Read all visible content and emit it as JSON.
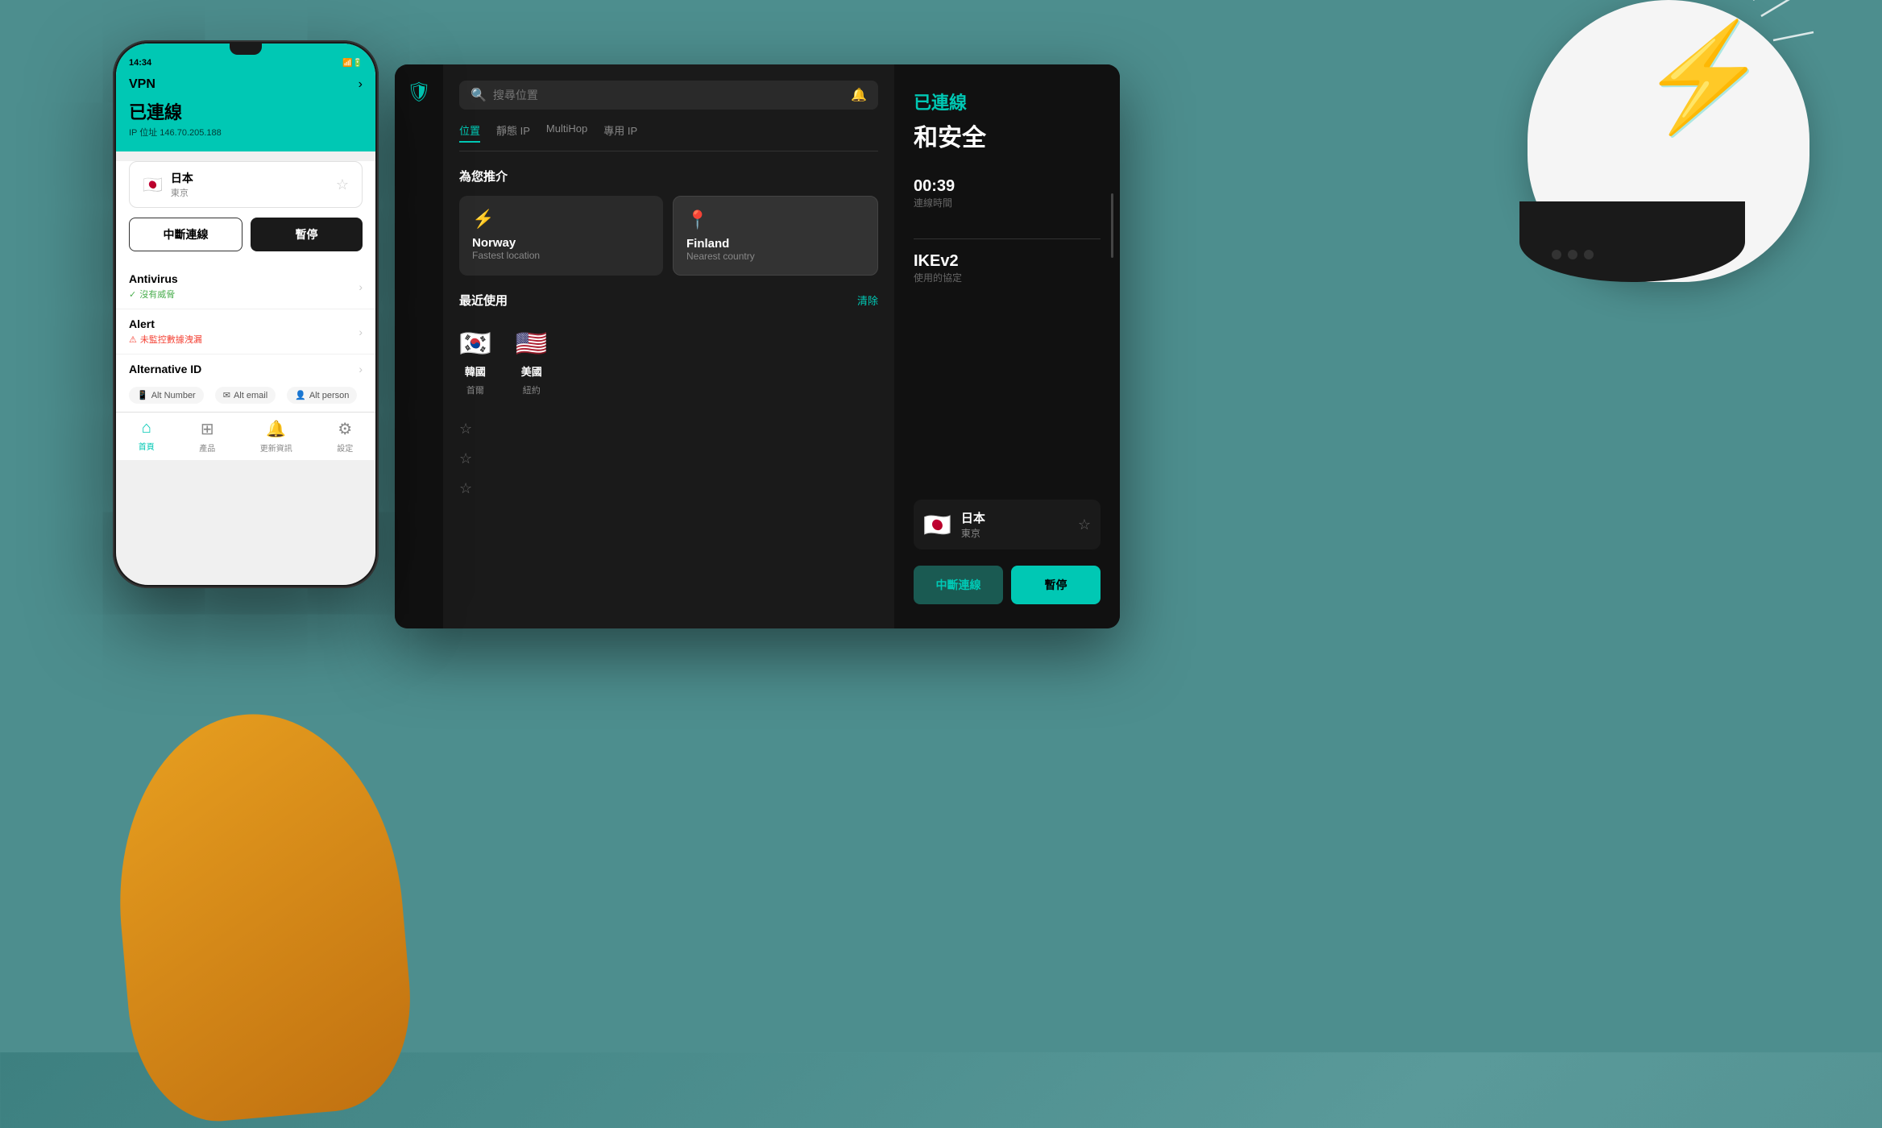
{
  "background": {
    "color": "#4d8e8e"
  },
  "phone": {
    "time": "14:34",
    "nav_title": "VPN",
    "connected_label": "已連線",
    "ip_label": "IP 位址 146.70.205.188",
    "country": "日本",
    "city": "東京",
    "disconnect_btn": "中斷連線",
    "pause_btn": "暫停",
    "antivirus_label": "Antivirus",
    "antivirus_status": "沒有威脅",
    "alert_label": "Alert",
    "alert_status": "未監控數據洩漏",
    "alt_id_label": "Alternative ID",
    "alt_number": "Alt Number",
    "alt_email": "Alt email",
    "alt_person": "Alt person",
    "nav_items": [
      {
        "label": "首頁",
        "active": true
      },
      {
        "label": "產品",
        "active": false
      },
      {
        "label": "更新資訊",
        "active": false
      },
      {
        "label": "設定",
        "active": false
      }
    ]
  },
  "desktop": {
    "search_placeholder": "搜尋位置",
    "tabs": [
      {
        "label": "位置",
        "active": true
      },
      {
        "label": "靜態 IP",
        "active": false
      },
      {
        "label": "MultiHop",
        "active": false
      },
      {
        "label": "專用 IP",
        "active": false
      }
    ],
    "recommended_title": "為您推介",
    "recommended": [
      {
        "name": "Norway",
        "sub": "Fastest location",
        "icon": "⚡"
      },
      {
        "name": "Finland",
        "sub": "Nearest country",
        "icon": "📍"
      }
    ],
    "recent_title": "最近使用",
    "clear_label": "清除",
    "recent_flags": [
      {
        "flag": "🇰🇷",
        "country": "韓國",
        "city": "首爾"
      },
      {
        "flag": "🇺🇸",
        "country": "美國",
        "city": "紐約"
      }
    ],
    "right_panel": {
      "connected_label": "已連線",
      "secure_label": "和安全",
      "time_value": "00:39",
      "time_label": "連線時間",
      "protocol_value": "IKEv2",
      "protocol_label": "使用的協定",
      "country": "日本",
      "city": "東京",
      "disconnect_btn": "中斷連線",
      "pause_btn": "暫停"
    }
  },
  "helmet": {
    "lightning_char": "⚡"
  }
}
